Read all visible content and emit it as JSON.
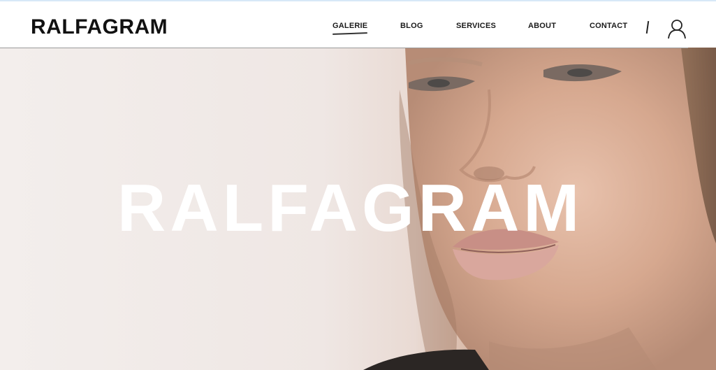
{
  "header": {
    "logo": "RALFAGRAM",
    "nav": [
      {
        "label": "GALERIE",
        "active": true
      },
      {
        "label": "BLOG",
        "active": false
      },
      {
        "label": "SERVICES",
        "active": false
      },
      {
        "label": "ABOUT",
        "active": false
      },
      {
        "label": "CONTACT",
        "active": false
      }
    ],
    "user_icon": "user-icon",
    "divider_icon": "divider-slash"
  },
  "hero": {
    "title": "RALFAGRAM",
    "image_subject": "close-up portrait of a woman's face"
  },
  "colors": {
    "background": "#f2ecea",
    "header": "#ffffff",
    "text": "#111111",
    "hero_title": "#ffffff"
  }
}
